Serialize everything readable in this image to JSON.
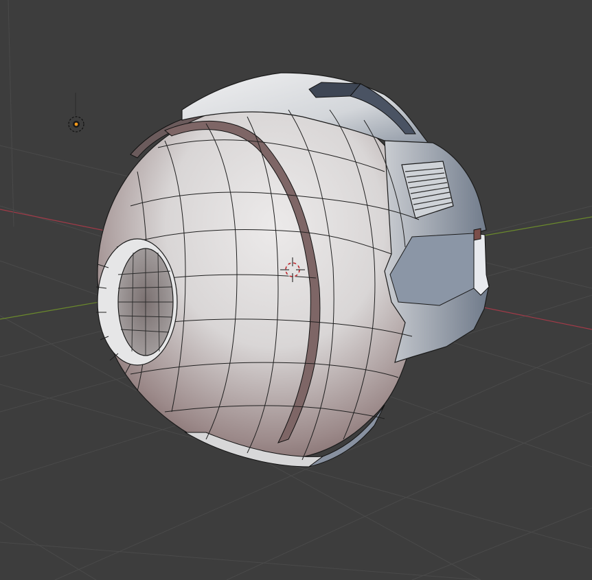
{
  "viewport": {
    "editor": "blender-3d-viewport",
    "shading": "solid",
    "overlays": "mesh-wireframe-edges",
    "background_color": "#3d3d3d",
    "grid_color": "#4a4a4a",
    "x_axis_color": "#a23a48",
    "y_axis_color": "#6b8a2c",
    "mesh_fill_light": "#e9e9ea",
    "mesh_fill_shadow": "#7f6565",
    "edge_color": "#1e1e1e"
  },
  "scene_objects": [
    {
      "name": "light-icon",
      "type": "light"
    },
    {
      "name": "3d-cursor",
      "type": "cursor"
    },
    {
      "name": "droid-head-mesh",
      "type": "mesh"
    }
  ]
}
